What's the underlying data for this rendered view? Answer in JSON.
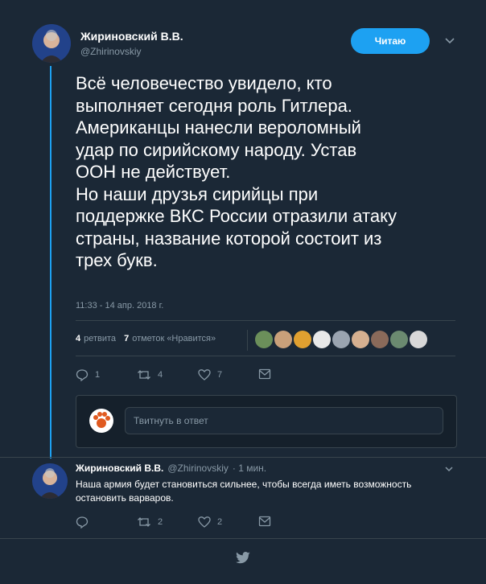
{
  "tweet": {
    "author_name": "Жириновский В.В.",
    "author_handle": "@Zhirinovskiy",
    "follow_label": "Читаю",
    "text_lines": [
      "Всё человечество увидело, кто",
      "выполняет сегодня роль Гитлера.",
      "Американцы нанесли вероломный",
      "удар по сирийскому народу. Устав",
      "ООН не действует.",
      "Но наши друзья сирийцы при",
      "поддержке ВКС России отразили атаку",
      "страны, название которой состоит из",
      "трех букв."
    ],
    "timestamp": "11:33 - 14 апр. 2018 г.",
    "retweets_count": "4",
    "retweets_label": "ретвита",
    "likes_count": "7",
    "likes_label": "отметок «Нравится»",
    "actions": {
      "reply": "1",
      "retweet": "4",
      "like": "7"
    }
  },
  "reply_box": {
    "placeholder": "Твитнуть в ответ"
  },
  "reply_tweet": {
    "author_name": "Жириновский В.В.",
    "author_handle": "@Zhirinovskiy",
    "time": "· 1 мин.",
    "text_lines": [
      "Наша армия будет становиться сильнее, чтобы всегда иметь возможность",
      "остановить варваров."
    ],
    "actions": {
      "reply": "",
      "retweet": "2",
      "like": "2"
    }
  },
  "colors": {
    "accent": "#1da1f2",
    "background": "#1b2836",
    "muted": "#8899a6"
  }
}
